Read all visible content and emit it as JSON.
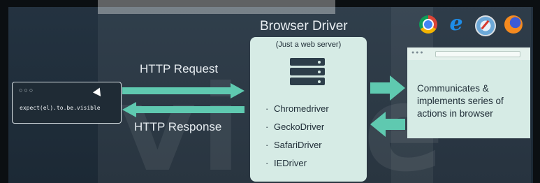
{
  "diagram": {
    "title": "Browser Driver",
    "server_subtitle": "(Just a web server)",
    "drivers": [
      "Chromedriver",
      "GeckoDriver",
      "SafariDriver",
      "IEDriver"
    ],
    "request_label": "HTTP Request",
    "response_label": "HTTP Response",
    "code_snippet": "expect(el).to.be.visible",
    "browser_text": "Communicates & implements series of actions in browser",
    "arrow_color": "#5fc9b0",
    "panel_color": "#d6ebe5"
  },
  "icons": [
    "chrome-icon",
    "internet-explorer-icon",
    "safari-icon",
    "firefox-icon",
    "server-icon"
  ]
}
